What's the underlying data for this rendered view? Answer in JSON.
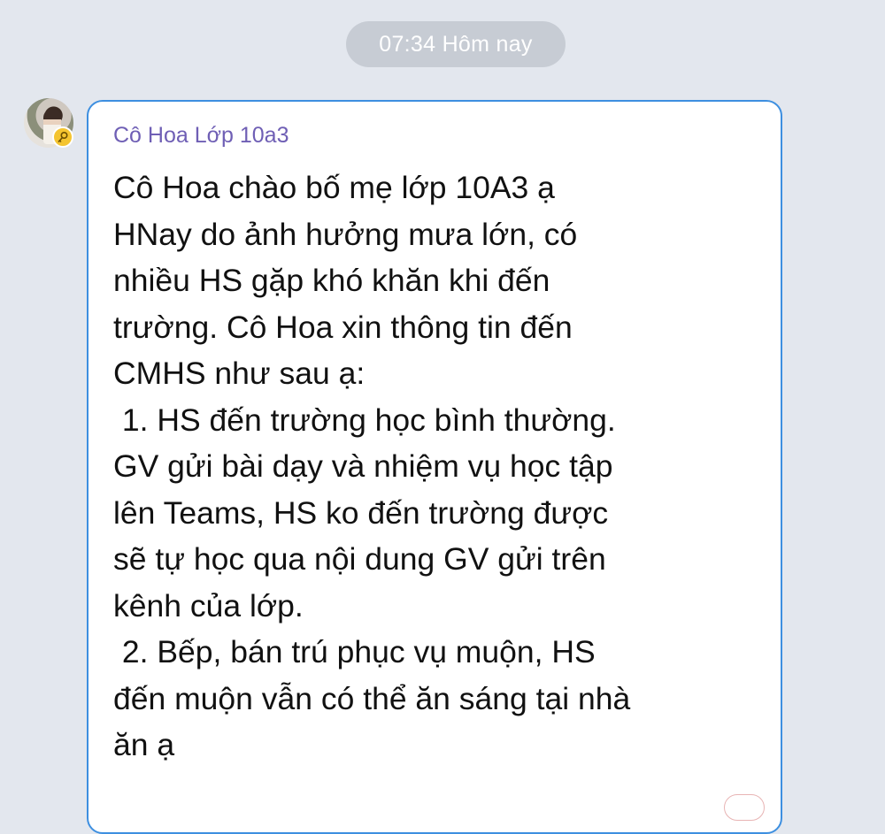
{
  "timestamp": "07:34 Hôm nay",
  "message": {
    "sender": "Cô Hoa Lớp 10a3",
    "lines": [
      "Cô Hoa chào bố mẹ lớp 10A3 ạ",
      "HNay do ảnh hưởng mưa lớn, có",
      "nhiều HS gặp khó khăn khi đến",
      "trường. Cô Hoa xin thông tin đến",
      "CMHS như sau ạ:",
      " 1. HS đến trường học bình thường.",
      "GV gửi bài dạy và nhiệm vụ học tập",
      "lên Teams, HS ko đến trường được",
      "sẽ tự học qua nội dung GV gửi trên",
      "kênh của lớp.",
      " 2. Bếp, bán trú phục vụ muộn, HS",
      "đến muộn vẫn có thể ăn sáng tại nhà",
      "ăn ạ"
    ]
  },
  "icons": {
    "avatar_badge": "key-icon",
    "badge_color": "#f4c430",
    "bubble_border_color": "#3d8fe0",
    "sender_color": "#6f5fb5"
  }
}
